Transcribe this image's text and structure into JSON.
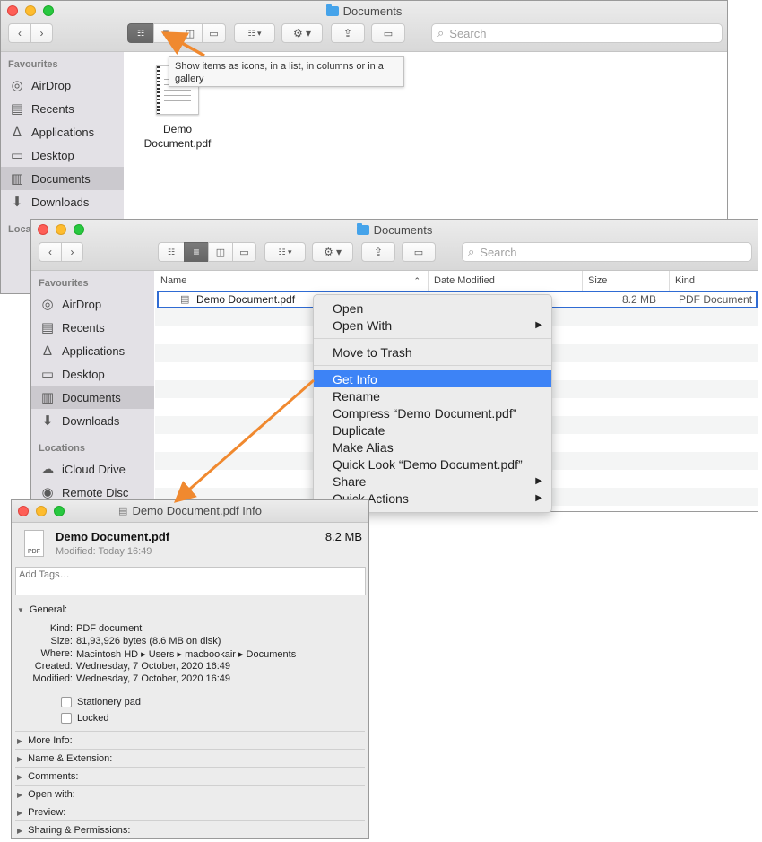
{
  "win1": {
    "title": "Documents",
    "search_placeholder": "Search",
    "sidebar_favourites": "Favourites",
    "sidebar_locations_cut": "Loca",
    "sidebar": [
      "AirDrop",
      "Recents",
      "Applications",
      "Desktop",
      "Documents",
      "Downloads"
    ],
    "tooltip": "Show items as icons, in a list, in columns or in a gallery",
    "file_label": "Demo Document.pdf"
  },
  "win2": {
    "title": "Documents",
    "search_placeholder": "Search",
    "sidebar_favourites": "Favourites",
    "sidebar_locations": "Locations",
    "sidebar": [
      "AirDrop",
      "Recents",
      "Applications",
      "Desktop",
      "Documents",
      "Downloads"
    ],
    "locations": [
      "iCloud Drive",
      "Remote Disc"
    ],
    "columns": {
      "name": "Name",
      "date": "Date Modified",
      "size": "Size",
      "kind": "Kind"
    },
    "row": {
      "name": "Demo Document.pdf",
      "size": "8.2 MB",
      "kind": "PDF Document"
    }
  },
  "context_menu": [
    "Open",
    "Open With",
    "Move to Trash",
    "Get Info",
    "Rename",
    "Compress “Demo Document.pdf”",
    "Duplicate",
    "Make Alias",
    "Quick Look “Demo Document.pdf”",
    "Share",
    "Quick Actions"
  ],
  "info": {
    "title": "Demo Document.pdf Info",
    "name": "Demo Document.pdf",
    "size": "8.2 MB",
    "modified": "Modified: Today 16:49",
    "tags_placeholder": "Add Tags…",
    "general": "General:",
    "fields": [
      {
        "label": "Kind:",
        "value": "PDF document"
      },
      {
        "label": "Size:",
        "value": "81,93,926 bytes (8.6 MB on disk)"
      },
      {
        "label": "Where:",
        "value": "Macintosh HD ▸ Users ▸ macbookair ▸ Documents"
      },
      {
        "label": "Created:",
        "value": "Wednesday, 7 October, 2020 16:49"
      },
      {
        "label": "Modified:",
        "value": "Wednesday, 7 October, 2020 16:49"
      }
    ],
    "stationery": "Stationery pad",
    "locked": "Locked",
    "sections": [
      "More Info:",
      "Name & Extension:",
      "Comments:",
      "Open with:",
      "Preview:",
      "Sharing & Permissions:"
    ],
    "pdf_badge": "PDF"
  },
  "colors": {
    "accent": "#3d83f6",
    "arrow": "#f0892f",
    "selection": "#2f6bd3"
  }
}
